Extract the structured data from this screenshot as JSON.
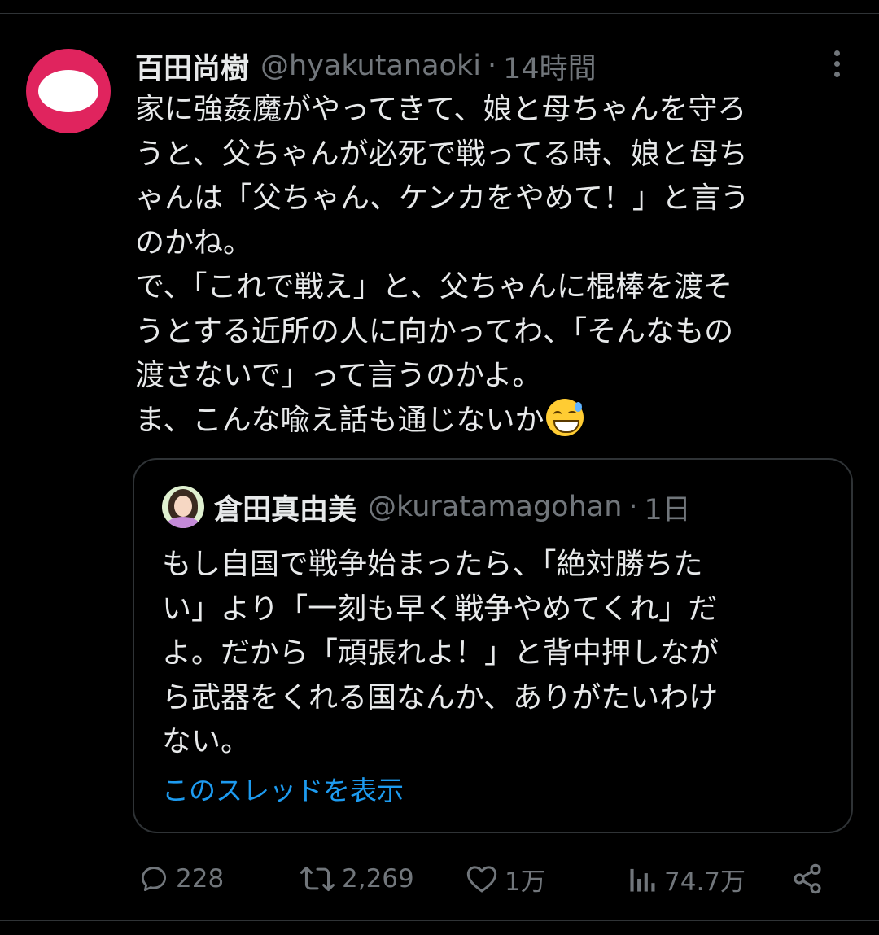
{
  "tweet": {
    "display_name": "百田尚樹",
    "handle": "@hyakutanaoki",
    "separator": "·",
    "time": "14時間",
    "body_lines": [
      "家に強姦魔がやってきて、娘と母ちゃんを守ろ",
      "うと、父ちゃんが必死で戦ってる時、娘と母ち",
      "ゃんは「父ちゃん、ケンカをやめて！」と言う",
      "のかね。",
      "で、「これで戦え」と、父ちゃんに棍棒を渡そ",
      "うとする近所の人に向かってわ、「そんなもの",
      "渡さないで」って言うのかよ。",
      "ま、こんな喩え話も通じないか"
    ],
    "emoji": "grinning-face-with-sweat"
  },
  "quote": {
    "display_name": "倉田真由美",
    "handle": "@kuratamagohan",
    "separator": "·",
    "time": "1日",
    "body_lines": [
      "もし自国で戦争始まったら、「絶対勝ちた",
      "い」より「一刻も早く戦争やめてくれ」だ",
      "よ。だから「頑張れよ！」と背中押しなが",
      "ら武器をくれる国なんか、ありがたいわけ",
      "ない。"
    ],
    "thread_link": "このスレッドを表示"
  },
  "actions": {
    "reply_count": "228",
    "retweet_count": "2,269",
    "like_count": "1万",
    "views_count": "74.7万"
  },
  "colors": {
    "background": "#000000",
    "text": "#e7e9ea",
    "muted": "#71767b",
    "link": "#1d9bf0",
    "border": "#2f3336",
    "avatar": "#e0245e"
  }
}
